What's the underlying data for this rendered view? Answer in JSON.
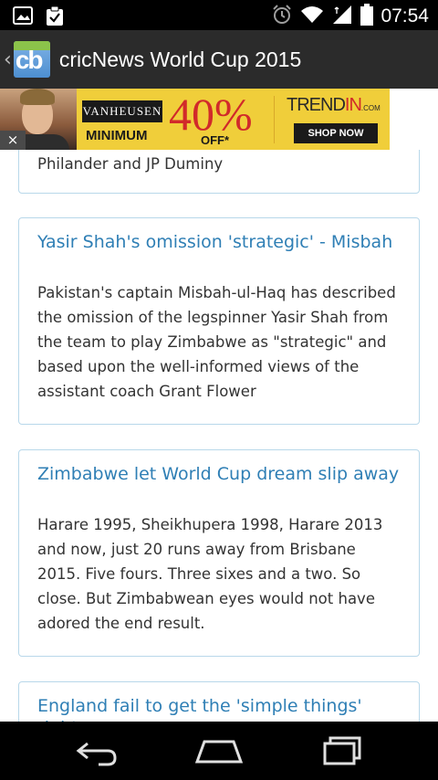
{
  "status_bar": {
    "time": "07:54",
    "left_icons": [
      "image-notification-icon",
      "clipboard-check-icon"
    ],
    "right_icons": [
      "alarm-icon",
      "wifi-icon",
      "signal-icon",
      "battery-icon"
    ]
  },
  "action_bar": {
    "logo_text": "cb",
    "title": "cricNews World Cup 2015"
  },
  "ad": {
    "brand": "VANHEUSEN",
    "minimum": "MINIMUM",
    "percent": "40%",
    "off": "OFF*",
    "trendin_prefix": "TREND",
    "trendin_in": "IN",
    "trendin_suffix": ".COM",
    "shop_now": "SHOP NOW",
    "close": "×"
  },
  "articles": [
    {
      "headline": "",
      "body": "Philander and JP Duminy"
    },
    {
      "headline": "Yasir Shah's omission 'strategic' - Misbah",
      "body": "Pakistan's captain Misbah-ul-Haq has described the omission of the legspinner Yasir Shah from the team to play Zimbabwe as \"strategic\" and based upon the well-informed views of the assistant coach Grant Flower"
    },
    {
      "headline": "Zimbabwe let World Cup dream slip away",
      "body": "Harare 1995, Sheikhupera 1998, Harare 2013 and now, just 20 runs away from Brisbane 2015. Five fours. Three sixes and a two. So close. But Zimbabwean eyes would not have adored the end result."
    },
    {
      "headline": "England fail to get the 'simple things' right",
      "body": ""
    }
  ],
  "nav": {
    "buttons": [
      "back-icon",
      "home-icon",
      "recent-apps-icon"
    ]
  }
}
